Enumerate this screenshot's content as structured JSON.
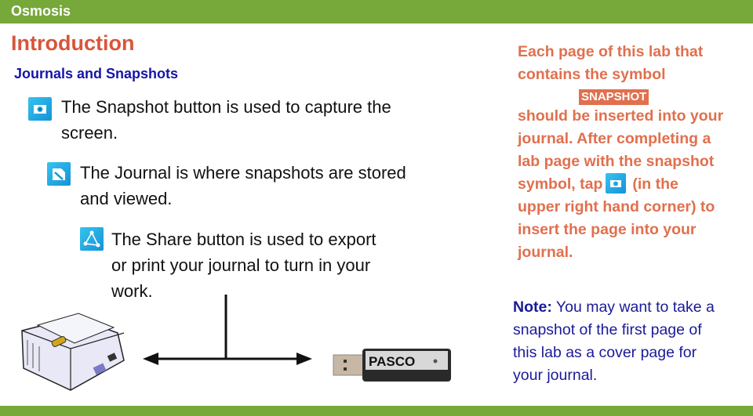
{
  "header": {
    "title": "Osmosis"
  },
  "page": {
    "title": "Introduction",
    "subtitle": "Journals and Snapshots"
  },
  "bullets": [
    {
      "icon": "snapshot-camera-icon",
      "lines": [
        "The Snapshot button is used to capture the",
        "screen."
      ]
    },
    {
      "icon": "journal-icon",
      "lines": [
        "The Journal is where snapshots are stored",
        "and viewed."
      ]
    },
    {
      "icon": "share-icon",
      "lines": [
        "The Share button is used to export",
        "or print your journal to turn in your",
        "work."
      ]
    }
  ],
  "instructions": {
    "line1": "Each page of this lab that",
    "line2": "contains the symbol",
    "symbol_label": "SNAPSHOT",
    "line3": "should be inserted into your",
    "line4": "journal.  After completing a",
    "line5": "lab page with the snapshot",
    "line6_before": "symbol, tap",
    "line6_after": "(in the",
    "line7": "upper right hand corner) to",
    "line8": "insert the page into your",
    "line9": "journal."
  },
  "note": {
    "label": "Note:",
    "lines": [
      " You may want to take a",
      "snapshot of the first page of",
      "this lab as a cover page for",
      "your journal."
    ]
  },
  "diagram": {
    "printer": "printer-image",
    "usb": "usb-flash-drive-image",
    "usb_brand": "PASCO"
  },
  "colors": {
    "bar": "#76a83a",
    "title": "#d8563a",
    "subtitle": "#1515a8",
    "instruction": "#e0704e",
    "note": "#1a1a99",
    "icon": "#1ea8e3"
  }
}
